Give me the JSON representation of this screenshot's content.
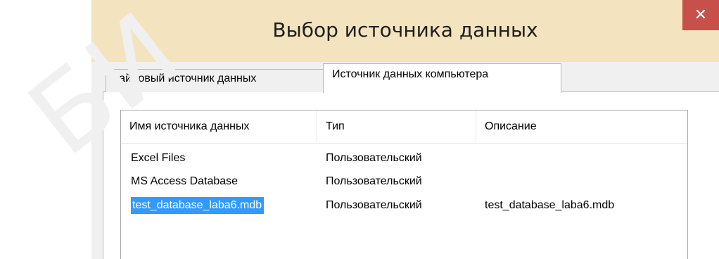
{
  "window": {
    "title": "Выбор источника данных",
    "close_label": "✕"
  },
  "tabs": [
    {
      "label": "Файловый источник данных",
      "active": false
    },
    {
      "label": "Источник данных компьютера",
      "active": true
    }
  ],
  "table": {
    "columns": [
      "Имя источника данных",
      "Тип",
      "Описание"
    ],
    "rows": [
      {
        "name": "Excel Files",
        "type": "Пользовательский",
        "description": ""
      },
      {
        "name": "MS Access Database",
        "type": "Пользовательский",
        "description": ""
      },
      {
        "name": "test_database_laba6.mdb",
        "type": "Пользовательский",
        "description": "test_database_laba6.mdb",
        "selected": true
      }
    ]
  },
  "colors": {
    "titlebar": "#f3e4bf",
    "close_button": "#c7504b",
    "selection": "#3399ff"
  },
  "watermark": "БИ"
}
